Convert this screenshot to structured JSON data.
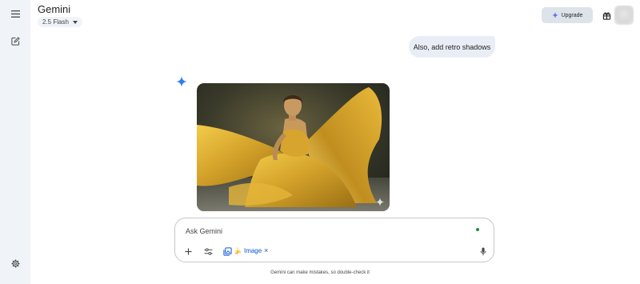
{
  "header": {
    "app_title": "Gemini",
    "model_label": "2.5 Flash",
    "upgrade_label": "Upgrade"
  },
  "rail": {
    "icons": [
      "menu-icon",
      "new-chat-icon",
      "settings-icon"
    ]
  },
  "conversation": {
    "user_message": "Also, add retro shadows",
    "response_image_alt": "Woman in flowing golden yellow silk dress"
  },
  "prompt": {
    "placeholder": "Ask Gemini",
    "tool_chip_emoji": "🍌",
    "tool_chip_label": "Image",
    "remove_symbol": "×"
  },
  "footer": {
    "disclaimer": "Gemini can make mistakes, so double-check it"
  },
  "colors": {
    "rail_bg": "#f0f4f9",
    "user_bubble": "#e9eef6",
    "accent_blue": "#0b57d0",
    "mic_active_green": "#1e8e3e"
  }
}
